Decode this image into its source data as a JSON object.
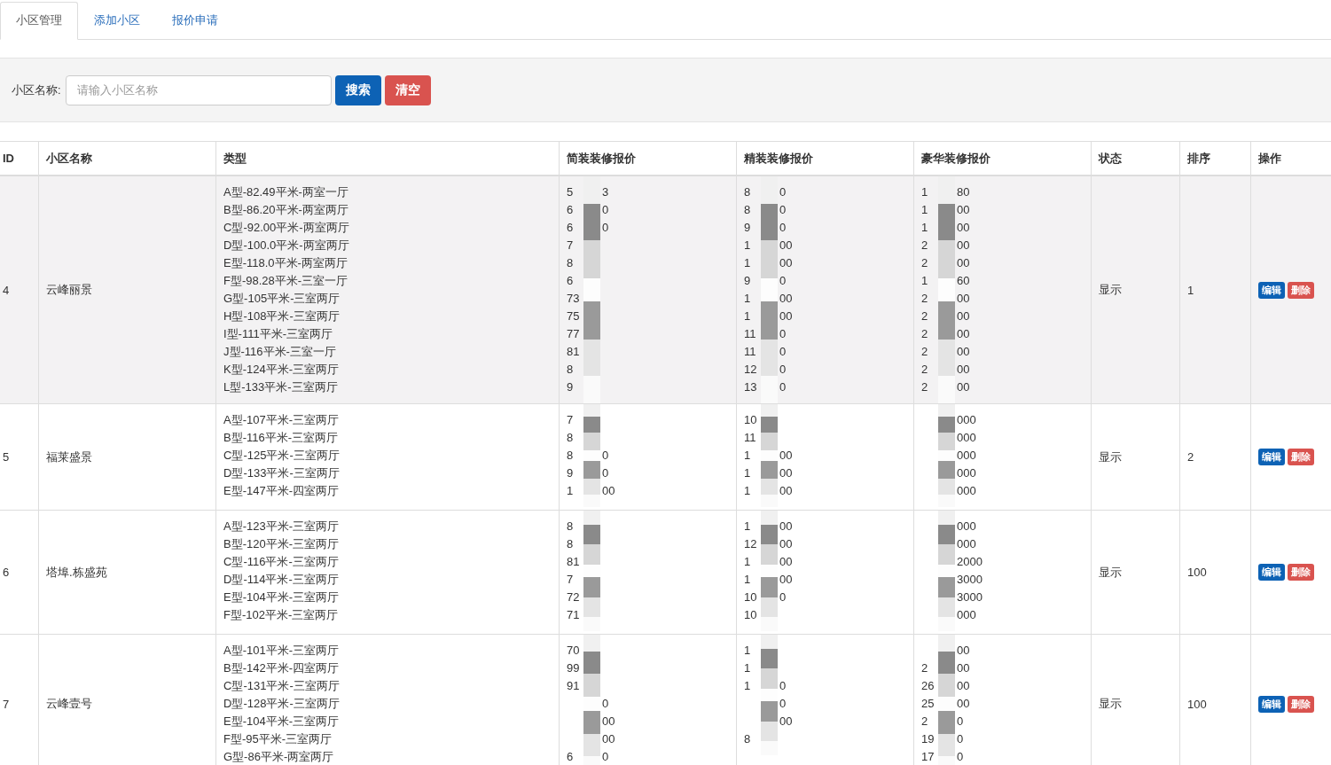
{
  "tabs": [
    {
      "label": "小区管理",
      "selected": true
    },
    {
      "label": "添加小区",
      "selected": false
    },
    {
      "label": "报价申请",
      "selected": false
    }
  ],
  "search": {
    "label": "小区名称:",
    "placeholder": "请输入小区名称",
    "buttons": [
      {
        "label": "搜索",
        "kind": "primary"
      },
      {
        "label": "清空",
        "kind": "danger"
      }
    ]
  },
  "table": {
    "columns": [
      "ID",
      "小区名称",
      "类型",
      "简装装修报价",
      "精装装修报价",
      "豪华装修报价",
      "状态",
      "排序",
      "操作"
    ],
    "rows": [
      {
        "id": "4",
        "name": "云峰丽景",
        "highlighted": true,
        "status": "显示",
        "order": "1",
        "actions": [
          "编辑",
          "删除"
        ],
        "types": [
          "A型-82.49平米-两室一厅",
          "B型-86.20平米-两室两厅",
          "C型-92.00平米-两室两厅",
          "D型-100.0平米-两室两厅",
          "E型-118.0平米-两室两厅",
          "F型-98.28平米-三室一厅",
          "G型-105平米-三室两厅",
          "H型-108平米-三室两厅",
          "I型-111平米-三室两厅",
          "J型-116平米-三室一厅",
          "K型-124平米-三室两厅",
          "L型-133平米-三室两厅"
        ],
        "prices": [
          [
            {
              "head": "5",
              "tail": "3"
            },
            {
              "head": "6",
              "tail": "0"
            },
            {
              "head": "6",
              "tail": "0"
            },
            {
              "head": "7"
            },
            {
              "head": "8"
            },
            {
              "head": "6"
            },
            {
              "head": "73"
            },
            {
              "head": "75"
            },
            {
              "head": "77"
            },
            {
              "head": "81"
            },
            {
              "head": "8"
            },
            {
              "head": "9"
            }
          ],
          [
            {
              "head": "8",
              "tail": "0"
            },
            {
              "head": "8",
              "tail": "0"
            },
            {
              "head": "9",
              "tail": "0"
            },
            {
              "head": "1",
              "tail": "00"
            },
            {
              "head": "1",
              "tail": "00"
            },
            {
              "head": "9",
              "tail": "0"
            },
            {
              "head": "1",
              "tail": "00"
            },
            {
              "head": "1",
              "tail": "00"
            },
            {
              "head": "11",
              "tail": "0"
            },
            {
              "head": "11",
              "tail": "0"
            },
            {
              "head": "12",
              "tail": "0"
            },
            {
              "head": "13",
              "tail": "0"
            }
          ],
          [
            {
              "head": "1",
              "tail": "80"
            },
            {
              "head": "1",
              "tail": "00"
            },
            {
              "head": "1",
              "tail": "00"
            },
            {
              "head": "2",
              "tail": "00"
            },
            {
              "head": "2",
              "tail": "00"
            },
            {
              "head": "1",
              "tail": "60"
            },
            {
              "head": "2",
              "tail": "00"
            },
            {
              "head": "2",
              "tail": "00"
            },
            {
              "head": "2",
              "tail": "00"
            },
            {
              "head": "2",
              "tail": "00"
            },
            {
              "head": "2",
              "tail": "00"
            },
            {
              "head": "2",
              "tail": "00"
            }
          ]
        ]
      },
      {
        "id": "5",
        "name": "福莱盛景",
        "highlighted": false,
        "status": "显示",
        "order": "2",
        "actions": [
          "编辑",
          "删除"
        ],
        "types": [
          "A型-107平米-三室两厅",
          "B型-116平米-三室两厅",
          "C型-125平米-三室两厅",
          "D型-133平米-三室两厅",
          "E型-147平米-四室两厅"
        ],
        "prices": [
          [
            {
              "head": "7"
            },
            {
              "head": "8"
            },
            {
              "head": "8",
              "tail": "0"
            },
            {
              "head": "9",
              "tail": "0"
            },
            {
              "head": "1",
              "tail": "00"
            }
          ],
          [
            {
              "head": "10"
            },
            {
              "head": "11"
            },
            {
              "head": "1",
              "tail": "00"
            },
            {
              "head": "1",
              "tail": "00"
            },
            {
              "head": "1",
              "tail": "00"
            }
          ],
          [
            {
              "tail": "000"
            },
            {
              "tail": "000"
            },
            {
              "tail": "000"
            },
            {
              "tail": "000"
            },
            {
              "tail": "000"
            }
          ]
        ]
      },
      {
        "id": "6",
        "name": "塔埠.栋盛苑",
        "highlighted": false,
        "status": "显示",
        "order": "100",
        "actions": [
          "编辑",
          "删除"
        ],
        "types": [
          "A型-123平米-三室两厅",
          "B型-120平米-三室两厅",
          "C型-116平米-三室两厅",
          "D型-114平米-三室两厅",
          "E型-104平米-三室两厅",
          "F型-102平米-三室两厅"
        ],
        "prices": [
          [
            {
              "head": "8"
            },
            {
              "head": "8"
            },
            {
              "head": "81"
            },
            {
              "head": "7"
            },
            {
              "head": "72"
            },
            {
              "head": "71"
            }
          ],
          [
            {
              "head": "1",
              "tail": "00"
            },
            {
              "head": "12",
              "tail": "00"
            },
            {
              "head": "1",
              "tail": "00"
            },
            {
              "head": "1",
              "tail": "00"
            },
            {
              "head": "10",
              "tail": "0"
            },
            {
              "head": "10"
            }
          ],
          [
            {
              "tail": "000"
            },
            {
              "tail": "000"
            },
            {
              "tail": "2000"
            },
            {
              "tail": "3000"
            },
            {
              "tail": "3000"
            },
            {
              "tail": "000"
            }
          ]
        ]
      },
      {
        "id": "7",
        "name": "云峰壹号",
        "highlighted": false,
        "status": "显示",
        "order": "100",
        "actions": [
          "编辑",
          "删除"
        ],
        "types": [
          "A型-101平米-三室两厅",
          "B型-142平米-四室两厅",
          "C型-131平米-三室两厅",
          "D型-128平米-三室两厅",
          "E型-104平米-三室两厅",
          "F型-95平米-三室两厅",
          "G型-86平米-两室两厅"
        ],
        "prices": [
          [
            {
              "head": "70"
            },
            {
              "head": "99"
            },
            {
              "head": "91"
            },
            {
              "tail": "0"
            },
            {
              "tail": "00"
            },
            {
              "tail": "00"
            },
            {
              "head": "6",
              "tail": "0"
            }
          ],
          [
            {
              "head": "1"
            },
            {
              "head": "1"
            },
            {
              "head": "1",
              "tail": "0"
            },
            {
              "tail": "0"
            },
            {
              "tail": "00"
            },
            {
              "head": "8"
            }
          ],
          [
            {
              "tail": "00"
            },
            {
              "head": "2",
              "tail": "00"
            },
            {
              "head": "26",
              "tail": "00"
            },
            {
              "head": "25",
              "tail": "00"
            },
            {
              "head": "2",
              "tail": "0"
            },
            {
              "head": "19",
              "tail": "0"
            },
            {
              "head": "17",
              "tail": "0"
            }
          ]
        ]
      }
    ]
  }
}
